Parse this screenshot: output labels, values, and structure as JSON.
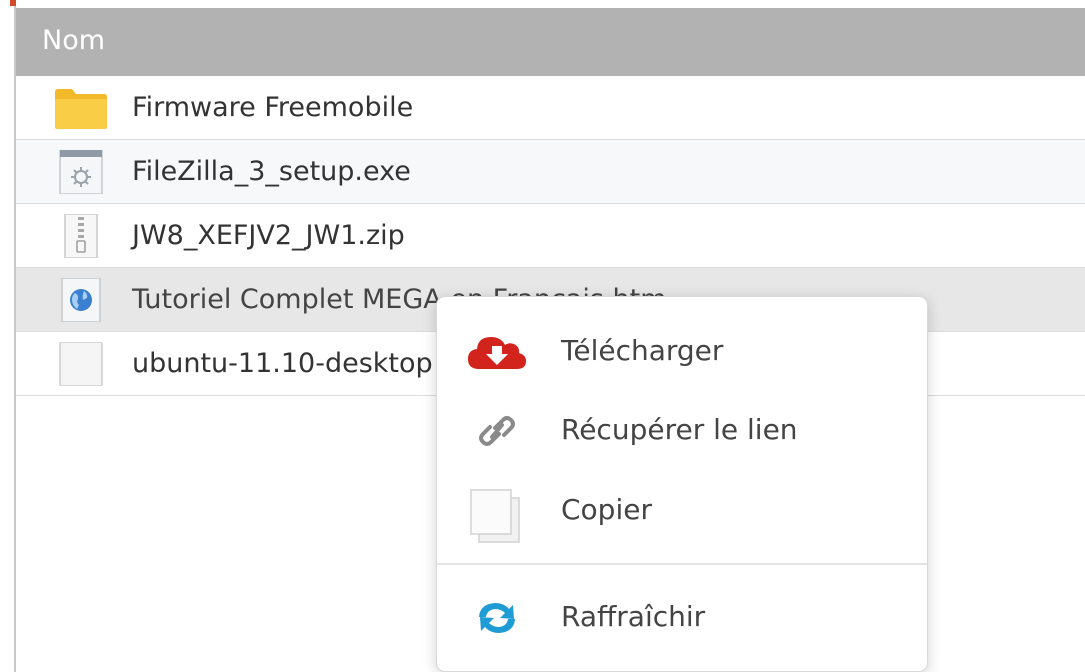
{
  "file_list": {
    "header": {
      "name_column": "Nom"
    },
    "rows": [
      {
        "name": "Firmware Freemobile",
        "icon": "folder-icon"
      },
      {
        "name": "FileZilla_3_setup.exe",
        "icon": "executable-file-icon"
      },
      {
        "name": "JW8_XEFJV2_JW1.zip",
        "icon": "zip-file-icon"
      },
      {
        "name": "Tutoriel Complet MEGA en Français.htm",
        "icon": "web-file-icon"
      },
      {
        "name": "ubuntu-11.10-desktop",
        "icon": "generic-file-icon"
      }
    ]
  },
  "context_menu": {
    "items": [
      {
        "label": "Télécharger",
        "icon": "cloud-download-icon"
      },
      {
        "label": "Récupérer le lien",
        "icon": "link-icon"
      },
      {
        "label": "Copier",
        "icon": "copy-icon"
      },
      {
        "label": "Raffraîchir",
        "icon": "refresh-icon"
      }
    ]
  },
  "colors": {
    "header_bg": "#b2b2b2",
    "folder": "#f7c83a",
    "download_red": "#d2231c",
    "refresh_blue": "#1f9bd6"
  }
}
